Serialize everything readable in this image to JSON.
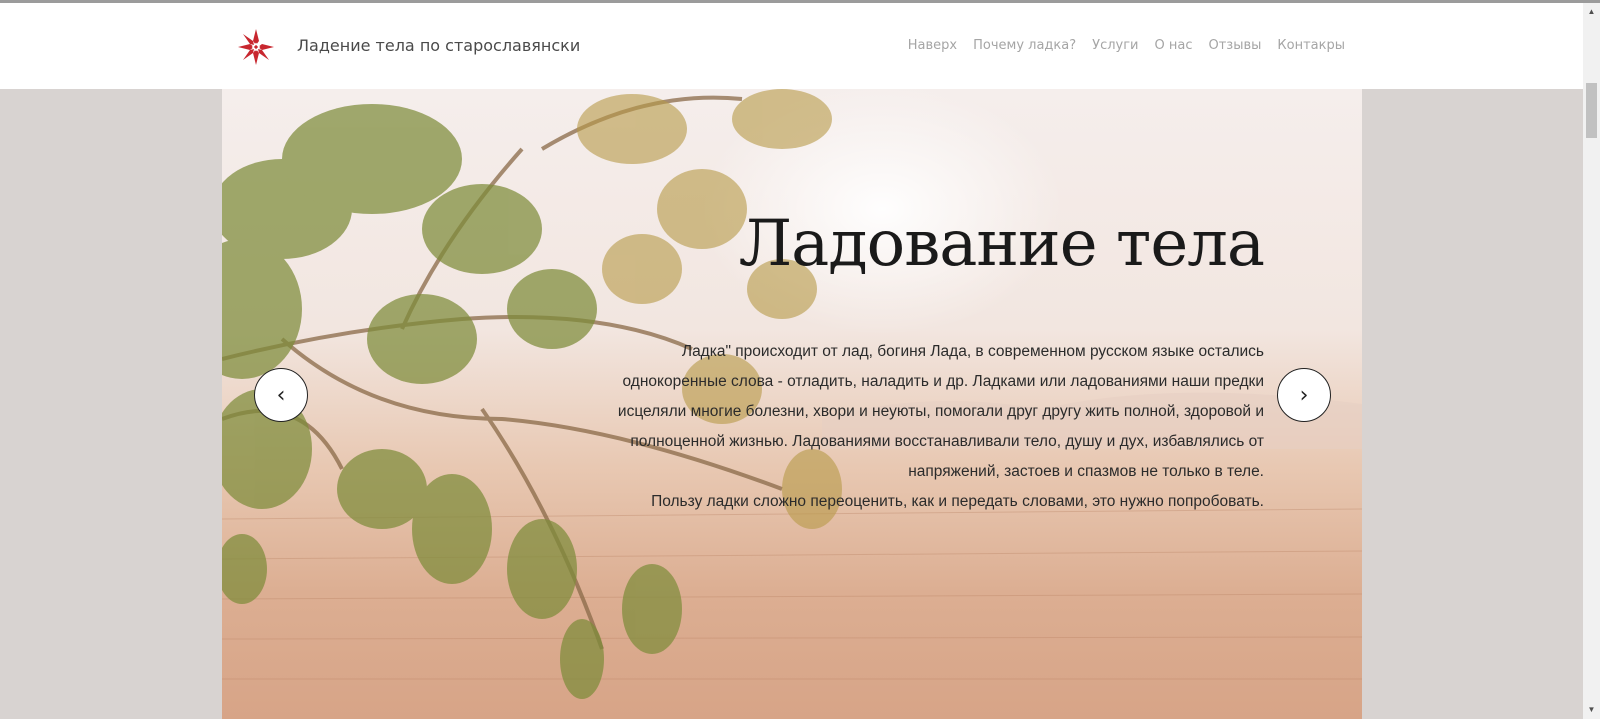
{
  "header": {
    "site_title": "Ладение тела по старославянски",
    "logo_icon": "red-star-ornament-icon",
    "brand_color": "#c8272f",
    "nav": [
      {
        "label": "Наверх"
      },
      {
        "label": "Почему ладка?"
      },
      {
        "label": "Услуги"
      },
      {
        "label": "О нас"
      },
      {
        "label": "Отзывы"
      },
      {
        "label": "Контакры"
      }
    ]
  },
  "hero": {
    "title": "Ладование тела",
    "paragraph_lines": [
      "Ладка\" происходит от лад, богиня Лада, в современном русском языке остались",
      "однокоренные слова - отладить, наладить и др. Ладками или ладованиями наши предки",
      "исцеляли многие болезни, хвори и неуюты, помогали друг другу жить полной, здоровой и",
      "полноценной жизнью. Ладованиями восстанавливали тело, душу и дух, избавлялись от",
      "напряжений, застоев и спазмов не только в теле.",
      "Пользу ладки сложно переоценить, как и передать словами, это нужно попробовать."
    ],
    "prev_icon": "chevron-left-icon",
    "next_icon": "chevron-right-icon",
    "prev_glyph": "‹",
    "next_glyph": "›"
  },
  "scrollbar": {
    "up_glyph": "▲",
    "down_glyph": "▼"
  }
}
